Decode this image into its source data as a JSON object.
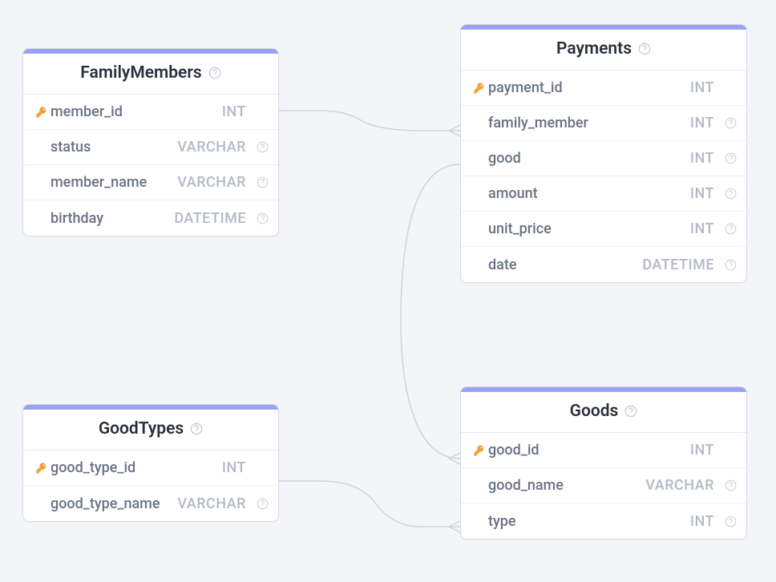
{
  "tables": {
    "familymembers": {
      "title": "FamilyMembers",
      "columns": [
        {
          "name": "member_id",
          "type": "INT",
          "pk": true,
          "help": false
        },
        {
          "name": "status",
          "type": "VARCHAR",
          "pk": false,
          "help": true
        },
        {
          "name": "member_name",
          "type": "VARCHAR",
          "pk": false,
          "help": true
        },
        {
          "name": "birthday",
          "type": "DATETIME",
          "pk": false,
          "help": true
        }
      ]
    },
    "payments": {
      "title": "Payments",
      "columns": [
        {
          "name": "payment_id",
          "type": "INT",
          "pk": true,
          "help": false
        },
        {
          "name": "family_member",
          "type": "INT",
          "pk": false,
          "help": true
        },
        {
          "name": "good",
          "type": "INT",
          "pk": false,
          "help": true
        },
        {
          "name": "amount",
          "type": "INT",
          "pk": false,
          "help": true
        },
        {
          "name": "unit_price",
          "type": "INT",
          "pk": false,
          "help": true
        },
        {
          "name": "date",
          "type": "DATETIME",
          "pk": false,
          "help": true
        }
      ]
    },
    "goodtypes": {
      "title": "GoodTypes",
      "columns": [
        {
          "name": "good_type_id",
          "type": "INT",
          "pk": true,
          "help": false
        },
        {
          "name": "good_type_name",
          "type": "VARCHAR",
          "pk": false,
          "help": true
        }
      ]
    },
    "goods": {
      "title": "Goods",
      "columns": [
        {
          "name": "good_id",
          "type": "INT",
          "pk": true,
          "help": false
        },
        {
          "name": "good_name",
          "type": "VARCHAR",
          "pk": false,
          "help": true
        },
        {
          "name": "type",
          "type": "INT",
          "pk": false,
          "help": true
        }
      ]
    }
  },
  "icons": {
    "key": "key-icon",
    "help": "help-icon"
  },
  "relations": [
    {
      "from": "familymembers.member_id",
      "to": "payments.family_member"
    },
    {
      "from": "payments.good",
      "to": "goods.good_id"
    },
    {
      "from": "goodtypes.good_type_id",
      "to": "goods.type"
    }
  ]
}
